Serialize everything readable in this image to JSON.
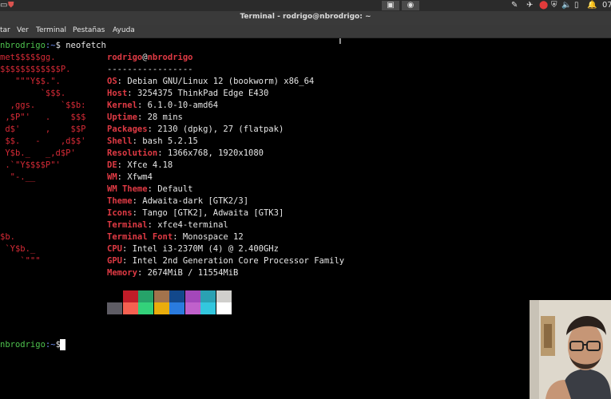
{
  "top_panel": {
    "clock": "07",
    "colors": {
      "background": "#2b2b2b",
      "foreground": "#e0e0e0"
    }
  },
  "window": {
    "title": "Terminal - rodrigo@nbrodrigo: ~"
  },
  "menu": {
    "items": [
      "tar",
      "Ver",
      "Terminal",
      "Pestañas",
      "Ayuda"
    ]
  },
  "terminal": {
    "prompt_user": "nbrodrigo",
    "prompt_path": ":~",
    "prompt_symbol": "$",
    "command": "neofetch",
    "logo_lines": [
      "met$$$$$gg.",
      "$$$$$$$$$$$$P.",
      "   \"\"\"Y$$.\".",
      "        `$$$.",
      "  ,ggs.     `$$b:",
      " ,$P\"'   .    $$$",
      " d$'     ,    $$P",
      " $$.   -    ,d$$'",
      " Y$b._   _,d$P'",
      " .`\"Y$$$$P\"'",
      "  \"-.__",
      "",
      "",
      "",
      "",
      "$b.",
      " `Y$b._",
      "    `\"\"\""
    ],
    "header_user": "rodrigo",
    "header_at": "@",
    "header_host": "nbrodrigo",
    "separator": "-----------------",
    "info": [
      {
        "key": "OS",
        "value": "Debian GNU/Linux 12 (bookworm) x86_64"
      },
      {
        "key": "Host",
        "value": "3254375 ThinkPad Edge E430"
      },
      {
        "key": "Kernel",
        "value": "6.1.0-10-amd64"
      },
      {
        "key": "Uptime",
        "value": "28 mins"
      },
      {
        "key": "Packages",
        "value": "2130 (dpkg), 27 (flatpak)"
      },
      {
        "key": "Shell",
        "value": "bash 5.2.15"
      },
      {
        "key": "Resolution",
        "value": "1366x768, 1920x1080"
      },
      {
        "key": "DE",
        "value": "Xfce 4.18"
      },
      {
        "key": "WM",
        "value": "Xfwm4"
      },
      {
        "key": "WM Theme",
        "value": "Default"
      },
      {
        "key": "Theme",
        "value": "Adwaita-dark [GTK2/3]"
      },
      {
        "key": "Icons",
        "value": "Tango [GTK2], Adwaita [GTK3]"
      },
      {
        "key": "Terminal",
        "value": "xfce4-terminal"
      },
      {
        "key": "Terminal Font",
        "value": "Monospace 12"
      },
      {
        "key": "CPU",
        "value": "Intel i3-2370M (4) @ 2.400GHz"
      },
      {
        "key": "GPU",
        "value": "Intel 2nd Generation Core Processor Family"
      },
      {
        "key": "Memory",
        "value": "2674MiB / 11554MiB"
      }
    ],
    "palette_row1": [
      "#000000",
      "#c01c28",
      "#26a269",
      "#a2734c",
      "#12488b",
      "#a347ba",
      "#2aa1b3",
      "#d0cfcc"
    ],
    "palette_row2": [
      "#5e5c64",
      "#f66151",
      "#33d17a",
      "#e9ad0c",
      "#2a7bde",
      "#c061cb",
      "#33c7de",
      "#ffffff"
    ]
  }
}
